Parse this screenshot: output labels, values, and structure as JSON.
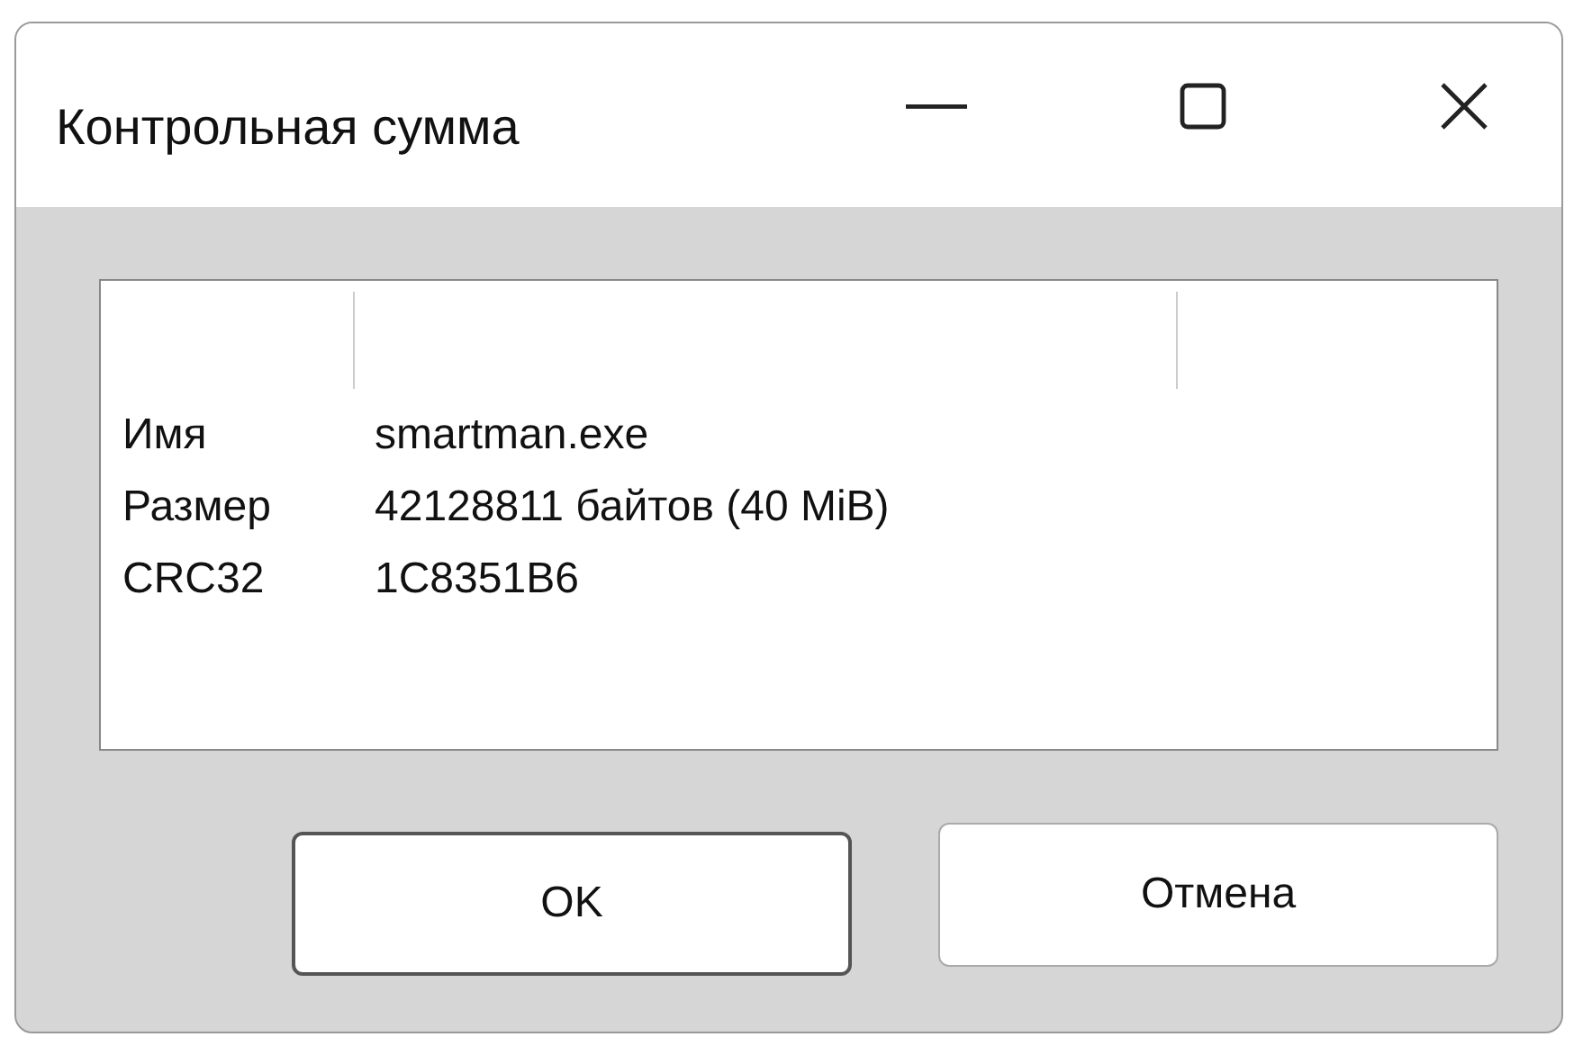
{
  "window": {
    "title": "Контрольная сумма"
  },
  "details": [
    {
      "label": "Имя",
      "value": "smartman.exe"
    },
    {
      "label": "Размер",
      "value": "42128811 байтов (40 MiB)"
    },
    {
      "label": "CRC32",
      "value": "1C8351B6"
    }
  ],
  "buttons": [
    {
      "label": "OK",
      "kind": "default"
    },
    {
      "label": "Отмена",
      "kind": "normal"
    }
  ]
}
